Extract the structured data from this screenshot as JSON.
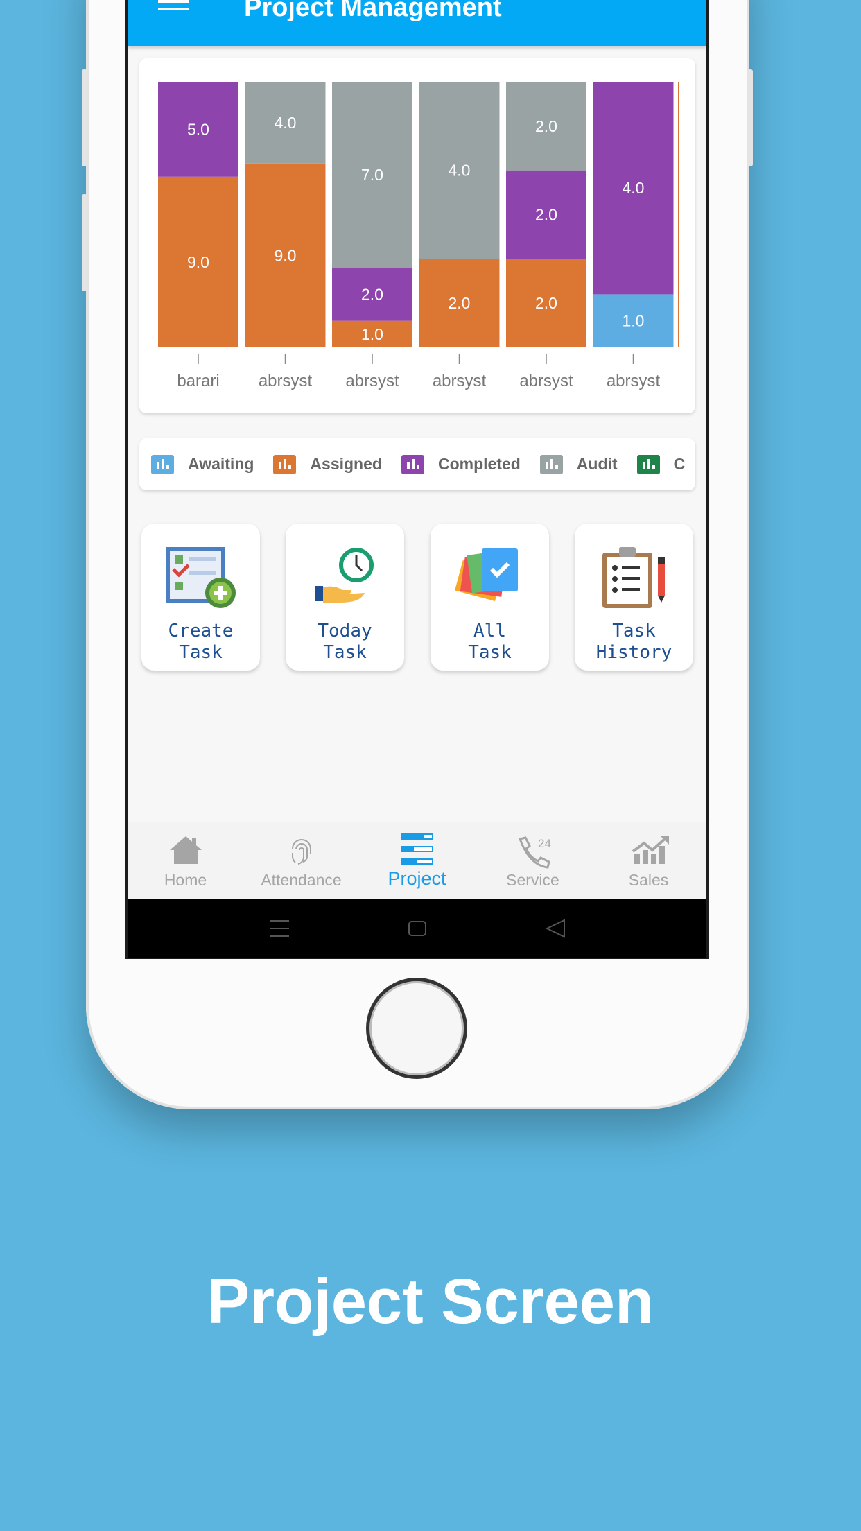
{
  "app": {
    "title": "Project Management",
    "menu_icon": "hamburger-menu-icon",
    "accent": "#03a9f4"
  },
  "chart_data": {
    "type": "bar",
    "stacked": true,
    "normalized": true,
    "categories": [
      "barari",
      "abrsyst",
      "abrsyst",
      "abrsyst",
      "abrsyst",
      "abrsyst"
    ],
    "series": [
      {
        "name": "Awaiting",
        "color": "#5dade2",
        "values": [
          0,
          0,
          0,
          0,
          0,
          1
        ]
      },
      {
        "name": "Assigned",
        "color": "#dc7633",
        "values": [
          9,
          9,
          1,
          2,
          2,
          0
        ]
      },
      {
        "name": "Completed",
        "color": "#8e44ad",
        "values": [
          5,
          0,
          2,
          0,
          2,
          4
        ]
      },
      {
        "name": "Audit",
        "color": "#99a3a4",
        "values": [
          0,
          4,
          7,
          4,
          2,
          0
        ]
      }
    ],
    "value_label_format": "0.0",
    "legend_placement": "bottom",
    "grid": false
  },
  "legend": [
    {
      "label": "Awaiting",
      "color": "#5dade2"
    },
    {
      "label": "Assigned",
      "color": "#dc7633"
    },
    {
      "label": "Completed",
      "color": "#8e44ad"
    },
    {
      "label": "Audit",
      "color": "#99a3a4"
    },
    {
      "label": "C",
      "color": "#1e8449"
    }
  ],
  "tiles": [
    {
      "line1": "Create",
      "line2": "Task",
      "icon": "create-task-icon"
    },
    {
      "line1": "Today",
      "line2": "Task",
      "icon": "today-task-icon"
    },
    {
      "line1": "All",
      "line2": "Task",
      "icon": "all-task-icon"
    },
    {
      "line1": "Task",
      "line2": "History",
      "icon": "task-history-icon"
    }
  ],
  "tabs": [
    {
      "label": "Home",
      "icon": "home-icon"
    },
    {
      "label": "Attendance",
      "icon": "fingerprint-icon"
    },
    {
      "label": "Project",
      "icon": "project-icon",
      "active": true
    },
    {
      "label": "Service",
      "icon": "phone-24-icon",
      "badge": "24"
    },
    {
      "label": "Sales",
      "icon": "sales-chart-icon"
    }
  ],
  "caption": "Project Screen"
}
